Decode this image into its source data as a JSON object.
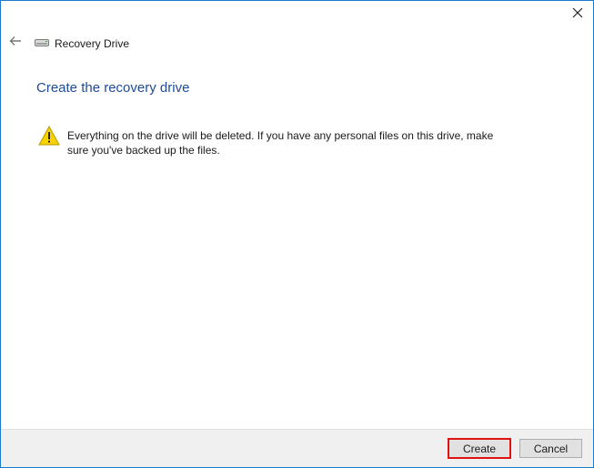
{
  "window": {
    "title": "Recovery Drive"
  },
  "page": {
    "heading": "Create the recovery drive",
    "warning_text": "Everything on the drive will be deleted. If you have any personal files on this drive, make sure you've backed up the files."
  },
  "footer": {
    "create_label": "Create",
    "cancel_label": "Cancel"
  },
  "colors": {
    "heading": "#1e4b9a",
    "window_border": "#1979ca",
    "highlight": "#e01313",
    "warning_yellow": "#f7d200"
  },
  "icons": {
    "close": "close-icon",
    "back": "back-arrow-icon",
    "app": "drive-icon",
    "warning": "warning-icon"
  }
}
